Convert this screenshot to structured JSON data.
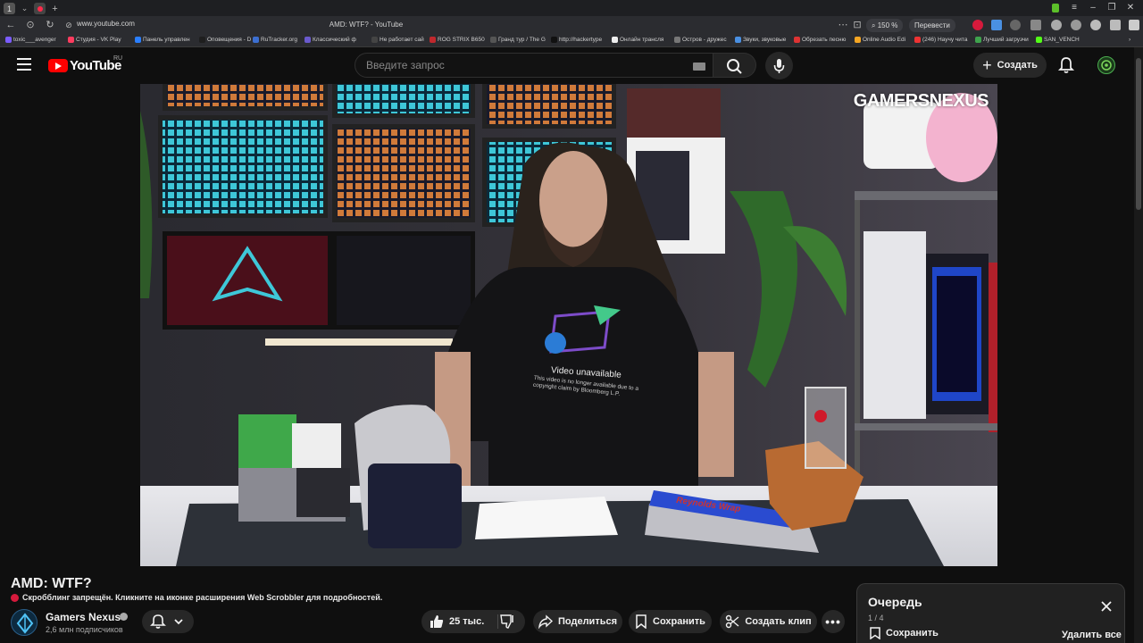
{
  "browser": {
    "tab_label": "1",
    "url": "www.youtube.com",
    "title": "AMD: WTF? - YouTube",
    "zoom": "150 %",
    "translate_label": "Перевести",
    "bookmarks": [
      {
        "label": "toxic___avenger",
        "color": "#7b5cff"
      },
      {
        "label": "Студия - VK Play",
        "color": "#ff3c5f"
      },
      {
        "label": "Панель управлен",
        "color": "#2a7fff"
      },
      {
        "label": "Оповещения - D",
        "color": "#1e1e1e"
      },
      {
        "label": "RuTracker.org",
        "color": "#3c6fd1"
      },
      {
        "label": "Классический ф",
        "color": "#6a5acd"
      },
      {
        "label": "Не работает сай",
        "color": "#444"
      },
      {
        "label": "ROG STRIX B650",
        "color": "#c0282d"
      },
      {
        "label": "Гранд тур / The G",
        "color": "#555"
      },
      {
        "label": "http://hackertype",
        "color": "#111"
      },
      {
        "label": "Онлайн трансля",
        "color": "#eee"
      },
      {
        "label": "Остров - дружес",
        "color": "#777"
      },
      {
        "label": "Звуки, звуковые",
        "color": "#4a90e2"
      },
      {
        "label": "Обрезать песню",
        "color": "#d33"
      },
      {
        "label": "Online Audio Edi",
        "color": "#f5a623"
      },
      {
        "label": "(246) Научу чита",
        "color": "#e33"
      },
      {
        "label": "Лучший загрузчи",
        "color": "#3fa34d"
      },
      {
        "label": "SAN_VENCH",
        "color": "#53fc18"
      }
    ]
  },
  "header": {
    "logo_text": "YouTube",
    "country": "RU",
    "search_placeholder": "Введите запрос",
    "create_label": "Создать"
  },
  "video": {
    "watermark": "GAMERSNEXUS",
    "shirt_text": "Video unavailable",
    "shirt_subtext": "This video is no longer available due to a copyright claim by Bloomberg L.P.",
    "foil_brand": "Reynolds Wrap"
  },
  "meta": {
    "title": "AMD: WTF?",
    "scrobble_notice": "Скробблинг запрещён. Кликните на иконке расширения Web Scrobbler для подробностей.",
    "channel_name": "Gamers Nexus",
    "subscribers": "2,6 млн подписчиков",
    "likes": "25 тыс.",
    "share_label": "Поделиться",
    "save_label": "Сохранить",
    "clip_label": "Создать клип"
  },
  "queue": {
    "title": "Очередь",
    "position": "1 / 4",
    "save_label": "Сохранить",
    "clear_label": "Удалить все"
  }
}
